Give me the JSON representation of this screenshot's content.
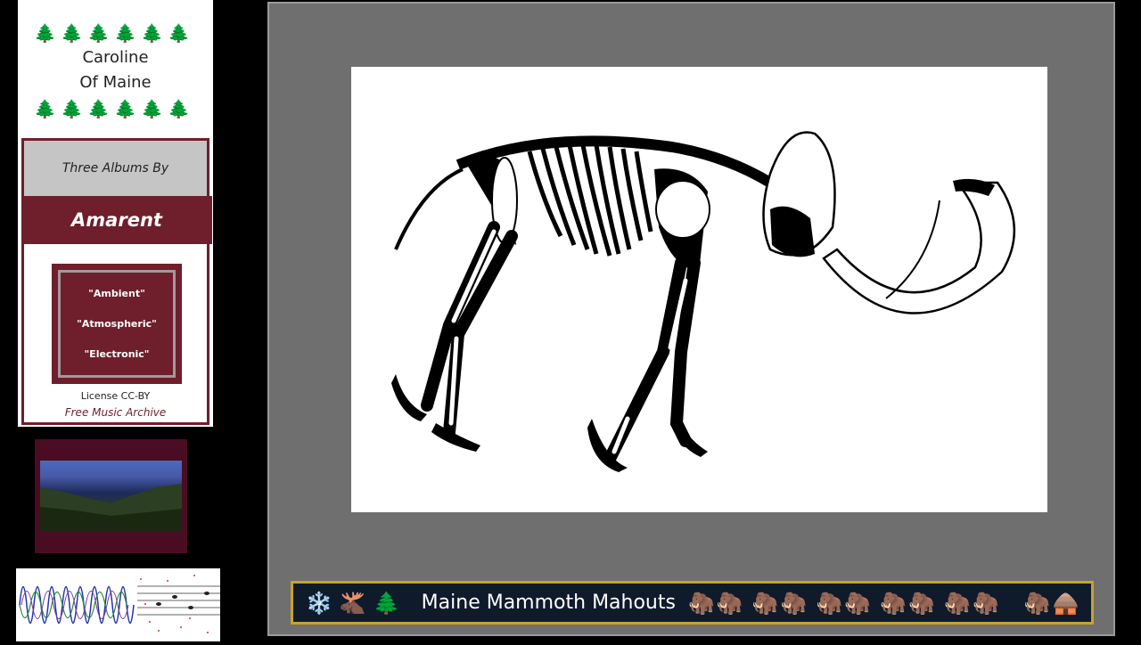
{
  "poster": {
    "tree_icon": "🌲",
    "title_line1": "Caroline",
    "title_line2": "Of Maine",
    "byline": "Three Albums By",
    "artist": "Amarent",
    "genres": [
      "\"Ambient\"",
      "\"Atmospheric\"",
      "\"Electronic\""
    ],
    "license": "License   CC-BY",
    "source": "Free Music Archive",
    "accent_color": "#6e1f2b"
  },
  "ticker": {
    "icons_left": [
      "❄️",
      "🫎",
      "🌲"
    ],
    "title": "Maine Mammoth Mahouts",
    "mammoth_icon": "🦣",
    "end_icon": "🛖"
  }
}
